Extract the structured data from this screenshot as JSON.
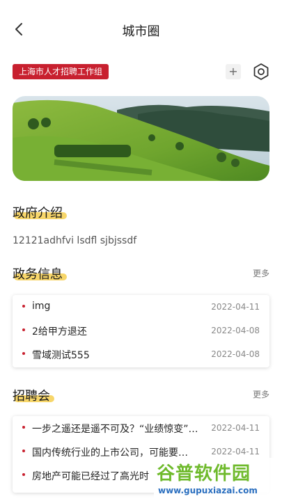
{
  "header": {
    "title": "城市圈"
  },
  "org_tag": {
    "label": "上海市人才招聘工作组"
  },
  "add_button": {
    "label": "+"
  },
  "gov_intro": {
    "title": "政府介绍",
    "text": "12121adhfvi lsdfl sjbjssdf"
  },
  "gov_affairs": {
    "title": "政务信息",
    "more_label": "更多",
    "items": [
      {
        "title": "img",
        "date": "2022-04-11"
      },
      {
        "title": "2给甲方退还",
        "date": "2022-04-08"
      },
      {
        "title": "雪域测试555",
        "date": "2022-04-08"
      }
    ]
  },
  "job_fair": {
    "title": "招聘会",
    "more_label": "更多",
    "items": [
      {
        "title": "一步之遥还是遥不可及？“业绩惊变”…",
        "date": "2022-04-11"
      },
      {
        "title": "国内传统行业的上市公司，可能要…",
        "date": "2022-04-11"
      },
      {
        "title": "房地产可能已经过了高光时",
        "date": ""
      }
    ]
  },
  "watermark": {
    "main": "谷普软件园",
    "url": "www.gupuxiazai.com"
  },
  "colors": {
    "accent_red": "#c8202f",
    "highlight_yellow": "#f6d15a"
  }
}
